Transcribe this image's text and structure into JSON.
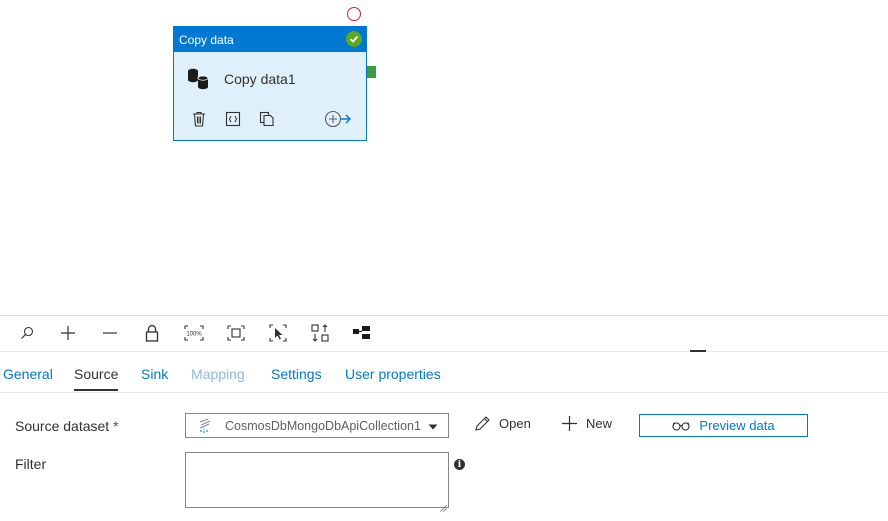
{
  "canvas": {
    "activity": {
      "type_label": "Copy data",
      "name": "Copy data1",
      "status": "succeeded",
      "actions": [
        "delete-icon",
        "code-icon",
        "copy-icon",
        "next-activity-icon"
      ]
    }
  },
  "toolbar": {
    "tools": [
      "search-icon",
      "zoom-in-icon",
      "zoom-out-icon",
      "lock-icon",
      "zoom-100-icon",
      "fit-to-screen-icon",
      "select-icon",
      "auto-align-icon",
      "layout-icon"
    ],
    "zoom_100_label": "100%"
  },
  "tabs": [
    {
      "label": "General",
      "state": "normal"
    },
    {
      "label": "Source",
      "state": "active"
    },
    {
      "label": "Sink",
      "state": "normal"
    },
    {
      "label": "Mapping",
      "state": "disabled"
    },
    {
      "label": "Settings",
      "state": "normal"
    },
    {
      "label": "User properties",
      "state": "normal"
    }
  ],
  "form": {
    "source_dataset_label": "Source dataset",
    "required_marker": "*",
    "source_dataset_value": "CosmosDbMongoDbApiCollection1",
    "open_label": "Open",
    "new_label": "New",
    "preview_label": "Preview data",
    "filter_label": "Filter",
    "filter_value": "",
    "info_glyph": "i"
  },
  "colors": {
    "accent": "#0078d4",
    "card_fill": "#dff0fb",
    "success": "#5ba824",
    "error": "#d8222a",
    "disabled_tab": "#8fb8de"
  }
}
